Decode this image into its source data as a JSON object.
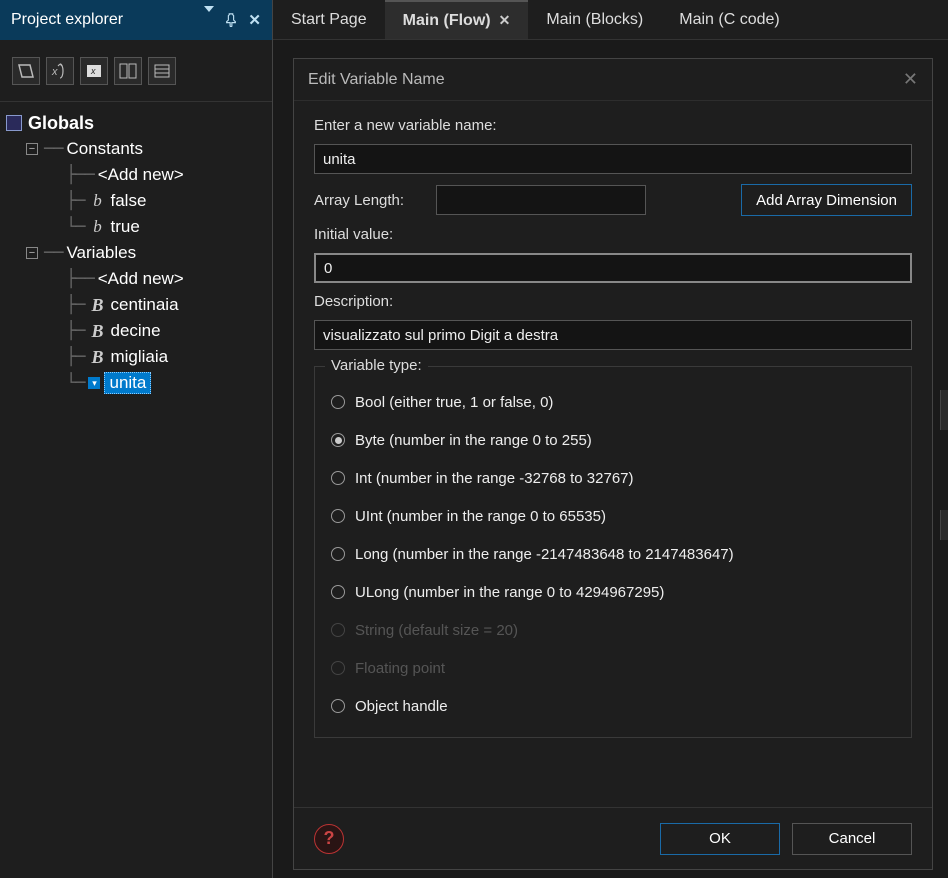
{
  "panel": {
    "title": "Project explorer"
  },
  "tabs": [
    {
      "label": "Start Page",
      "active": false,
      "closable": false
    },
    {
      "label": "Main (Flow)",
      "active": true,
      "closable": true
    },
    {
      "label": "Main (Blocks)",
      "active": false,
      "closable": false
    },
    {
      "label": "Main (C code)",
      "active": false,
      "closable": false
    }
  ],
  "tree": {
    "root": "Globals",
    "constants": {
      "label": "Constants",
      "add": "<Add new>",
      "items": [
        "false",
        "true"
      ]
    },
    "variables": {
      "label": "Variables",
      "add": "<Add new>",
      "items": [
        "centinaia",
        "decine",
        "migliaia",
        "unita"
      ],
      "selected": "unita"
    }
  },
  "dialog": {
    "title": "Edit Variable Name",
    "prompt": "Enter a new variable name:",
    "name_value": "unita",
    "array_length_label": "Array Length:",
    "array_length_value": "",
    "add_array_btn": "Add Array Dimension",
    "initial_value_label": "Initial value:",
    "initial_value": "0",
    "description_label": "Description:",
    "description_value": "visualizzato sul primo Digit a destra",
    "variable_type_label": "Variable type:",
    "types": [
      {
        "label": "Bool (either true, 1 or false, 0)",
        "checked": false,
        "enabled": true
      },
      {
        "label": "Byte (number in the range 0 to 255)",
        "checked": true,
        "enabled": true
      },
      {
        "label": "Int (number in the range -32768 to 32767)",
        "checked": false,
        "enabled": true
      },
      {
        "label": "UInt (number in the range 0 to 65535)",
        "checked": false,
        "enabled": true
      },
      {
        "label": "Long (number in the range -2147483648 to 2147483647)",
        "checked": false,
        "enabled": true
      },
      {
        "label": "ULong (number in the range 0 to 4294967295)",
        "checked": false,
        "enabled": true
      },
      {
        "label": "String (default size = 20)",
        "checked": false,
        "enabled": false
      },
      {
        "label": "Floating point",
        "checked": false,
        "enabled": false
      },
      {
        "label": "Object handle",
        "checked": false,
        "enabled": true
      }
    ],
    "ok": "OK",
    "cancel": "Cancel",
    "help": "?"
  }
}
